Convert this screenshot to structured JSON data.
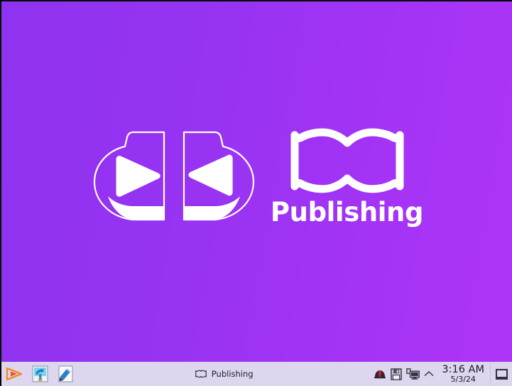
{
  "desktop": {
    "background_gradient_from": "#8e33ef",
    "background_gradient_to": "#ae35f7",
    "logo": {
      "mark_name": "bookend-arrows-logo",
      "book_icon_name": "open-book-icon",
      "wordmark": "Publishing",
      "color": "#ffffff"
    }
  },
  "taskbar": {
    "background": "#ded6ee",
    "quick_launch": [
      {
        "name": "media-player-icon",
        "label": "Media Player"
      },
      {
        "name": "paint-program-icon",
        "label": "Paint"
      },
      {
        "name": "text-editor-icon",
        "label": "Editor"
      }
    ],
    "task_button": {
      "label": "Publishing",
      "icon_name": "open-book-icon"
    },
    "tray": [
      {
        "name": "security-alert-icon",
        "label": "Security alert"
      },
      {
        "name": "save-disk-icon",
        "label": "Save"
      },
      {
        "name": "network-monitor-icon",
        "label": "Network"
      },
      {
        "name": "chevron-up-icon",
        "label": "Show hidden icons"
      }
    ],
    "clock": {
      "time": "3:16 AM",
      "date": "5/3/24"
    },
    "show_desktop": {
      "name": "show-desktop-button",
      "label": "Show desktop"
    }
  }
}
